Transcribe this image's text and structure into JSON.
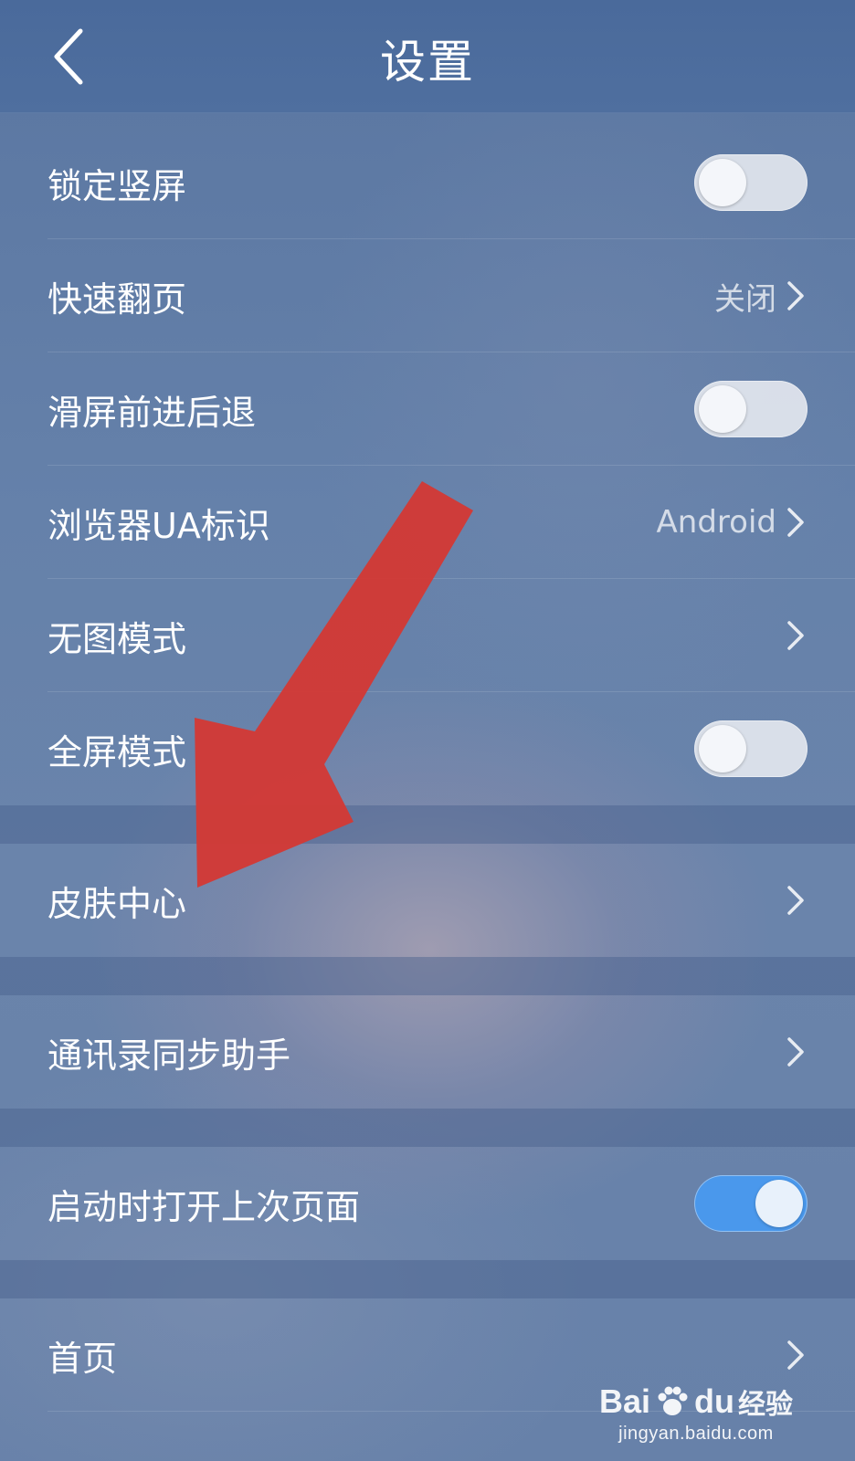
{
  "header": {
    "title": "设置"
  },
  "rows": [
    {
      "label": "锁定竖屏",
      "control": "toggle",
      "on": false
    },
    {
      "label": "快速翻页",
      "control": "value",
      "value": "关闭"
    },
    {
      "label": "滑屏前进后退",
      "control": "toggle",
      "on": false
    },
    {
      "label": "浏览器UA标识",
      "control": "value",
      "value": "Android"
    },
    {
      "label": "无图模式",
      "control": "chevron"
    },
    {
      "label": "全屏模式",
      "control": "toggle",
      "on": false
    },
    {
      "label": "皮肤中心",
      "control": "chevron"
    },
    {
      "label": "通讯录同步助手",
      "control": "chevron"
    },
    {
      "label": "启动时打开上次页面",
      "control": "toggle",
      "on": true
    },
    {
      "label": "首页",
      "control": "chevron"
    }
  ],
  "icons": {
    "back": "chevron-left-icon",
    "chevron": "chevron-right-icon"
  },
  "colors": {
    "header_bg": "#4a6a9b",
    "toggle_on": "#4a98ec",
    "arrow": "#d23a36"
  },
  "watermark": {
    "logo_bai": "Bai",
    "logo_du": "du",
    "logo_suffix": "经验",
    "url": "jingyan.baidu.com"
  }
}
